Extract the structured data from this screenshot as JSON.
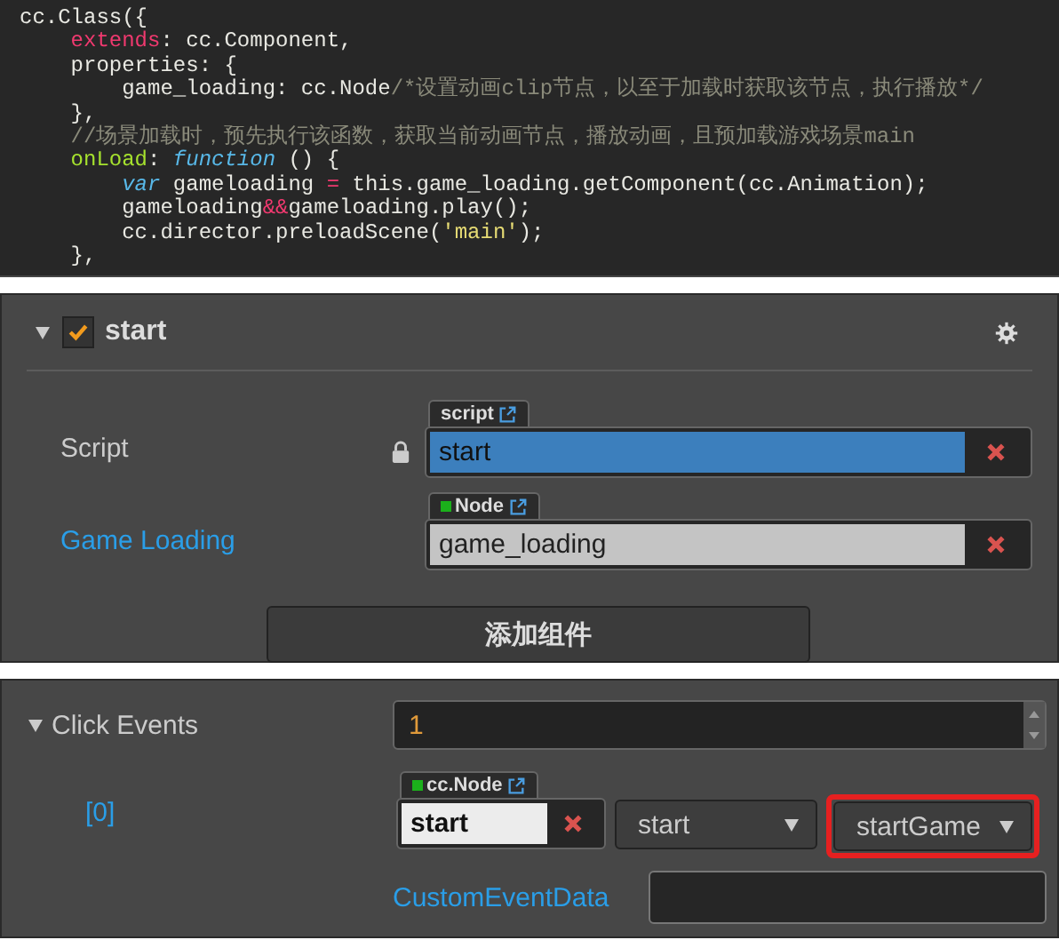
{
  "code_editor": {
    "lines": [
      {
        "tokens": [
          {
            "text": "cc.Class({",
            "kind": "plain"
          }
        ]
      },
      {
        "tokens": [
          {
            "text": "    extends",
            "kind": "keyword"
          },
          {
            "text": ": cc.Component,",
            "kind": "plain"
          }
        ]
      },
      {
        "tokens": [
          {
            "text": "    properties: {",
            "kind": "plain"
          }
        ]
      },
      {
        "tokens": [
          {
            "text": "        game_loading: cc.Node",
            "kind": "plain"
          },
          {
            "text": "/*设置动画clip节点，以至于加载时获取该节点，执行播放*/",
            "kind": "comment"
          }
        ]
      },
      {
        "tokens": [
          {
            "text": "    },",
            "kind": "plain"
          }
        ]
      },
      {
        "tokens": [
          {
            "text": "    //场景加载时，预先执行该函数，获取当前动画节点，播放动画，且预加载游戏场景main",
            "kind": "comment"
          }
        ]
      },
      {
        "tokens": [
          {
            "text": "    onLoad",
            "kind": "function-name"
          },
          {
            "text": ": ",
            "kind": "plain"
          },
          {
            "text": "function",
            "kind": "storage"
          },
          {
            "text": " () {",
            "kind": "plain"
          }
        ]
      },
      {
        "tokens": [
          {
            "text": "        var",
            "kind": "storage"
          },
          {
            "text": " gameloading ",
            "kind": "plain"
          },
          {
            "text": "=",
            "kind": "keyword"
          },
          {
            "text": " this.game_loading.getComponent(cc.Animation);",
            "kind": "plain"
          }
        ]
      },
      {
        "tokens": [
          {
            "text": "        gameloading",
            "kind": "plain"
          },
          {
            "text": "&&",
            "kind": "keyword"
          },
          {
            "text": "gameloading.play();",
            "kind": "plain"
          }
        ]
      },
      {
        "tokens": [
          {
            "text": "        cc.director.preloadScene(",
            "kind": "plain"
          },
          {
            "text": "'main'",
            "kind": "string"
          },
          {
            "text": ");",
            "kind": "plain"
          }
        ]
      },
      {
        "tokens": [
          {
            "text": "    },",
            "kind": "plain"
          }
        ]
      }
    ]
  },
  "component": {
    "name": "start",
    "expanded": true,
    "enabled": true,
    "properties": [
      {
        "kind": "script",
        "label": "Script",
        "tag": "script",
        "value": "start"
      },
      {
        "kind": "node",
        "label": "Game Loading",
        "tag": "Node",
        "value": "game_loading"
      }
    ],
    "add_component_button": "添加组件"
  },
  "click_events": {
    "label": "Click Events",
    "expanded": true,
    "count": "1",
    "items": [
      {
        "index": "[0]",
        "target_tag": "cc.Node",
        "target": "start",
        "component": "start",
        "handler": "startGame",
        "handler_highlighted": true,
        "custom_data_label": "CustomEventData"
      }
    ]
  }
}
